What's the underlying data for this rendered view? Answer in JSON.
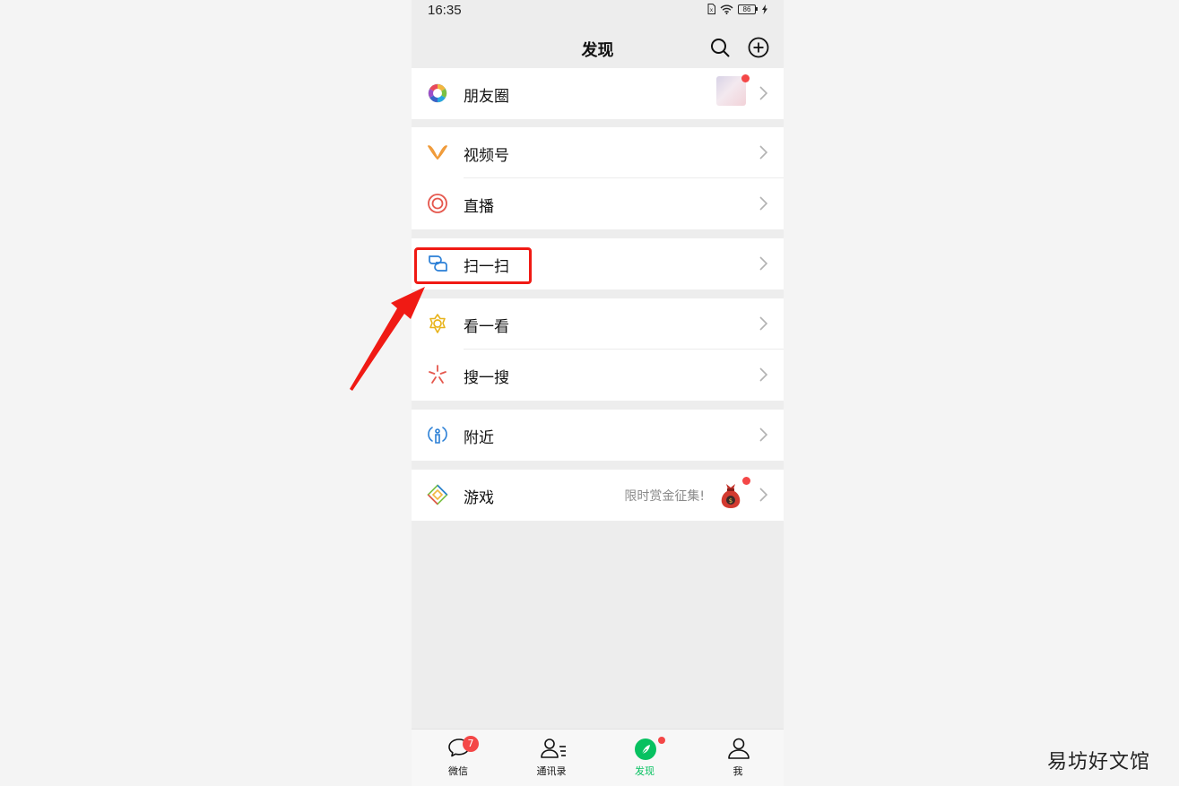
{
  "status_bar": {
    "time": "16:35",
    "battery": "86"
  },
  "nav": {
    "title": "发现"
  },
  "menu": {
    "moments": "朋友圈",
    "channels": "视频号",
    "live": "直播",
    "scan": "扫一扫",
    "top_stories": "看一看",
    "search": "搜一搜",
    "nearby": "附近",
    "games": "游戏",
    "games_promo": "限时赏金征集!"
  },
  "tabs": {
    "chats": "微信",
    "chats_badge": "7",
    "contacts": "通讯录",
    "discover": "发现",
    "me": "我"
  },
  "colors": {
    "accent_green": "#07c160",
    "highlight_red": "#f01a14",
    "badge_red": "#f44747"
  },
  "watermark": "易坊好文馆"
}
